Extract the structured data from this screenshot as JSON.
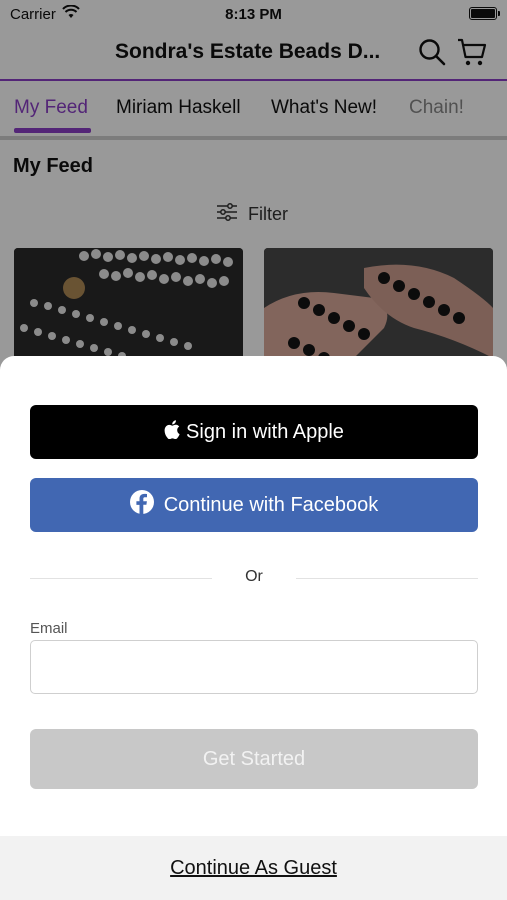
{
  "status_bar": {
    "carrier": "Carrier",
    "time": "8:13 PM"
  },
  "header": {
    "title": "Sondra's Estate Beads D..."
  },
  "tabs": [
    {
      "label": "My Feed"
    },
    {
      "label": "Miriam Haskell"
    },
    {
      "label": "What's New!"
    },
    {
      "label": "Chain!"
    }
  ],
  "feed": {
    "title": "My Feed",
    "filter_label": "Filter"
  },
  "login_sheet": {
    "apple_label": "Sign in with Apple",
    "facebook_label": "Continue with Facebook",
    "or_label": "Or",
    "email_label": "Email",
    "email_value": "",
    "get_started_label": "Get Started",
    "guest_label": "Continue As Guest"
  },
  "colors": {
    "accent": "#8a3fc7",
    "facebook": "#4167b2",
    "apple": "#000000",
    "disabled_button": "#c8c8c8"
  },
  "icons": [
    "wifi-icon",
    "battery-icon",
    "search-icon",
    "cart-icon",
    "filter-icon",
    "apple-icon",
    "facebook-icon"
  ]
}
